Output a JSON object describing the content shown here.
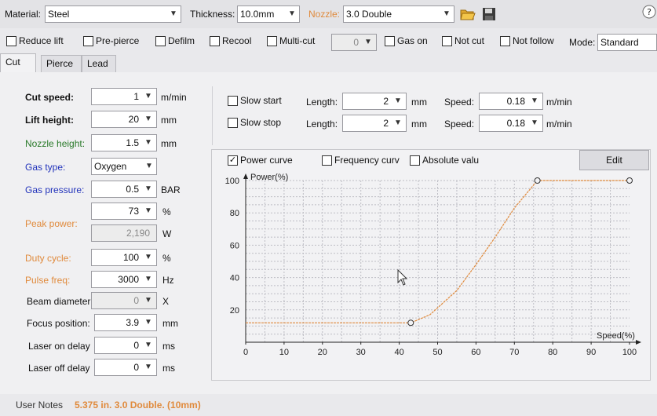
{
  "toolbar": {
    "material_label": "Material:",
    "material_value": "Steel",
    "thickness_label": "Thickness:",
    "thickness_value": "10.0mm",
    "nozzle_label": "Nozzle:",
    "nozzle_value": "3.0 Double"
  },
  "options": {
    "reduce_lift": "Reduce lift",
    "pre_pierce": "Pre-pierce",
    "defilm": "Defilm",
    "recool": "Recool",
    "multi_cut": "Multi-cut",
    "multi_cut_count": "0",
    "gas_on": "Gas on",
    "not_cut": "Not cut",
    "not_follow": "Not follow",
    "mode_label": "Mode:",
    "mode_value": "Standard"
  },
  "tabs": [
    "Cut",
    "Pierce",
    "Lead"
  ],
  "params": {
    "cut_speed": {
      "label": "Cut speed:",
      "value": "1",
      "unit": "m/min"
    },
    "lift_height": {
      "label": "Lift height:",
      "value": "20",
      "unit": "mm"
    },
    "nozzle_height": {
      "label": "Nozzle height:",
      "value": "1.5",
      "unit": "mm"
    },
    "gas_type": {
      "label": "Gas type:",
      "value": "Oxygen"
    },
    "gas_pressure": {
      "label": "Gas pressure:",
      "value": "0.5",
      "unit": "BAR"
    },
    "peak_power": {
      "label": "Peak power:",
      "value_pct": "73",
      "unit_pct": "%",
      "value_w": "2,190",
      "unit_w": "W"
    },
    "duty_cycle": {
      "label": "Duty cycle:",
      "value": "100",
      "unit": "%"
    },
    "pulse_freq": {
      "label": "Pulse freq:",
      "value": "3000",
      "unit": "Hz"
    },
    "beam_diameter": {
      "label": "Beam diameter",
      "value": "0",
      "unit": "X"
    },
    "focus_position": {
      "label": "Focus position:",
      "value": "3.9",
      "unit": "mm"
    },
    "laser_on_delay": {
      "label": "Laser on delay",
      "value": "0",
      "unit": "ms"
    },
    "laser_off_delay": {
      "label": "Laser off delay",
      "value": "0",
      "unit": "ms"
    }
  },
  "slow": {
    "slow_start": "Slow start",
    "slow_stop": "Slow stop",
    "length_label": "Length:",
    "start_length": "2",
    "stop_length": "2",
    "length_unit": "mm",
    "speed_label": "Speed:",
    "start_speed": "0.18",
    "stop_speed": "0.18",
    "speed_unit": "m/min"
  },
  "curve": {
    "power_curve": "Power curve",
    "frequency_curve": "Frequency curv",
    "absolute_value": "Absolute valu",
    "edit": "Edit"
  },
  "chart_data": {
    "type": "line",
    "title": "",
    "ylabel": "Power(%)",
    "xlabel": "Speed(%)",
    "xlim": [
      0,
      100
    ],
    "ylim": [
      0,
      100
    ],
    "xticks": [
      0,
      10,
      20,
      30,
      40,
      50,
      60,
      70,
      80,
      90,
      100
    ],
    "yticks": [
      20,
      40,
      60,
      80,
      100
    ],
    "grid": true,
    "series": [
      {
        "color": "#e08a3c",
        "x": [
          0,
          43,
          48,
          55,
          60,
          65,
          70,
          76,
          100
        ],
        "y": [
          12,
          12,
          17,
          32,
          48,
          65,
          83,
          100,
          100
        ],
        "control_points": [
          {
            "x": 43,
            "y": 12
          },
          {
            "x": 76,
            "y": 100
          },
          {
            "x": 100,
            "y": 100
          }
        ]
      }
    ]
  },
  "footer": {
    "notes_label": "User Notes",
    "notes_value": "5.375 in. 3.0 Double. (10mm)"
  },
  "colors": {
    "blue_label": "#2233bb",
    "orange_label": "#e08a3c",
    "green_label": "#2a7a2a",
    "curve": "#e08a3c"
  }
}
